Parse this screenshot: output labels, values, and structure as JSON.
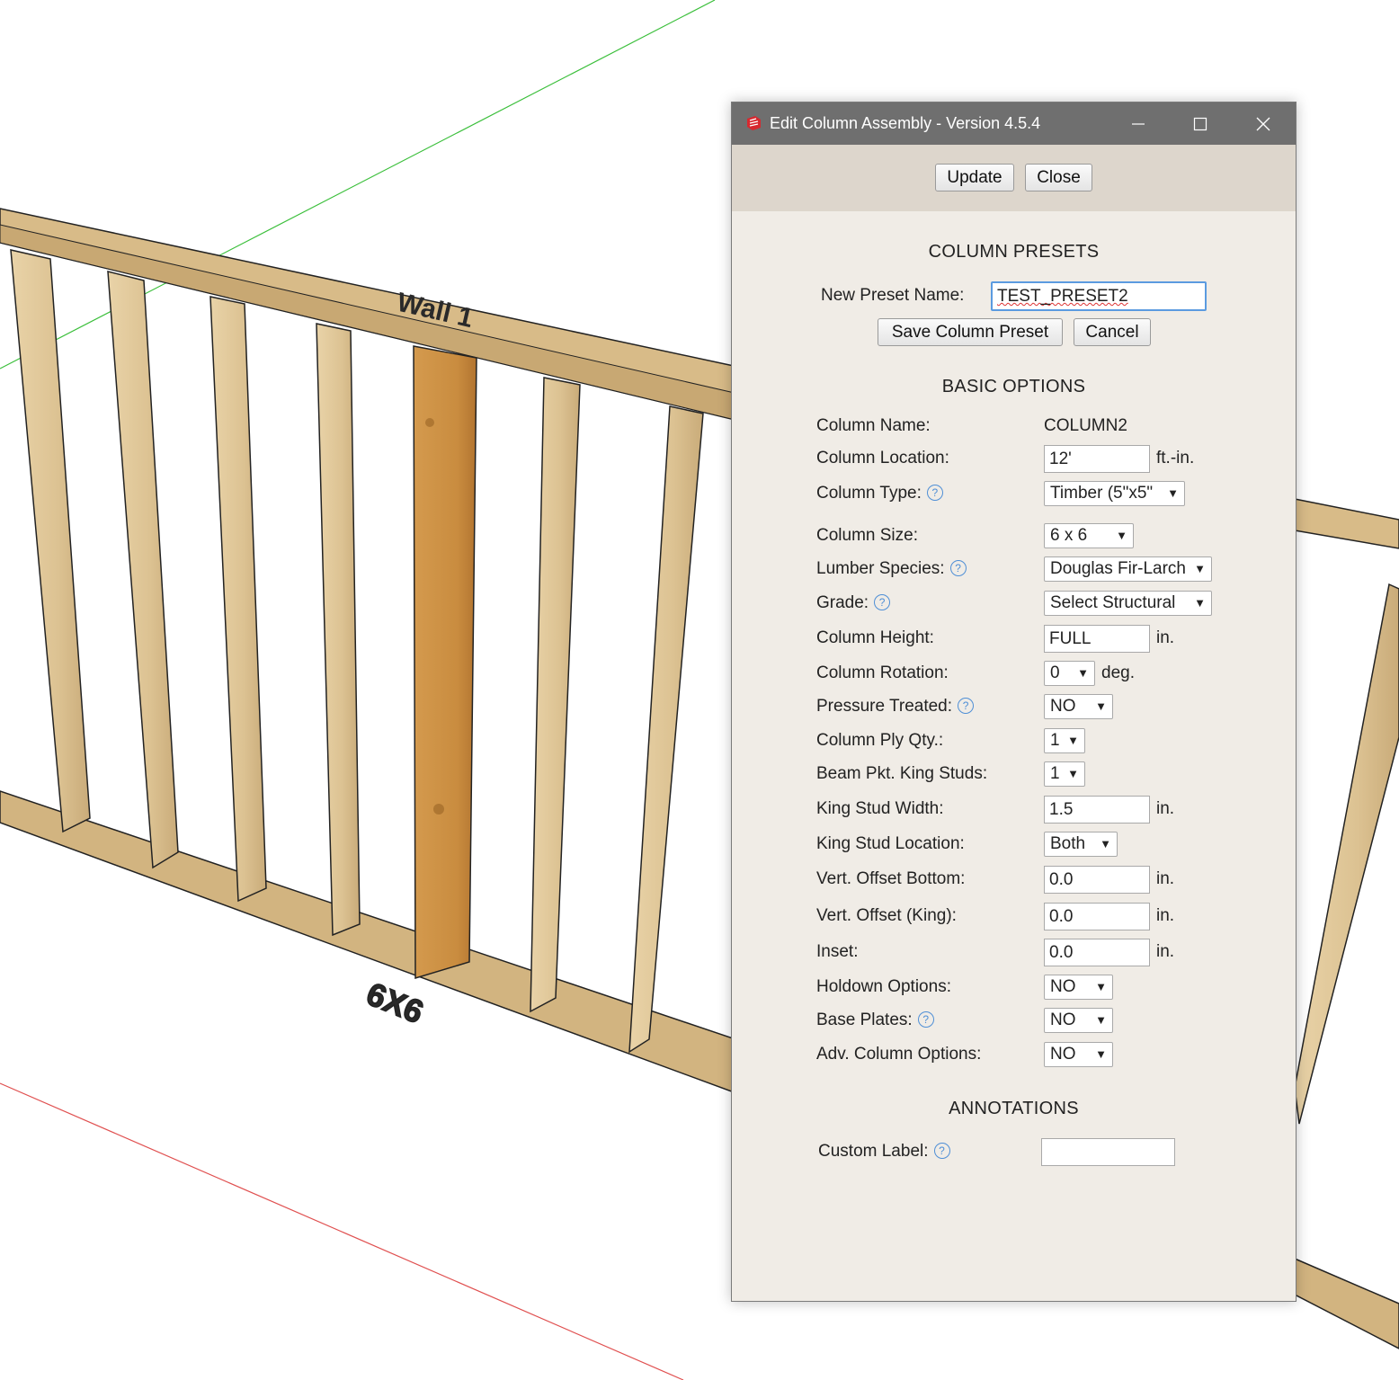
{
  "scene": {
    "wall_label": "Wall 1",
    "column_label": "6X6"
  },
  "dialog": {
    "title": "Edit Column Assembly - Version 4.5.4",
    "window_controls": {
      "minimize_icon": "minimize-icon",
      "maximize_icon": "maximize-icon",
      "close_icon": "close-icon"
    },
    "toolbar": {
      "update_label": "Update",
      "close_label": "Close"
    },
    "presets": {
      "heading": "COLUMN PRESETS",
      "new_name_label": "New Preset Name:",
      "new_name_value": "TEST_PRESET2",
      "save_label": "Save Column Preset",
      "cancel_label": "Cancel"
    },
    "basic": {
      "heading": "BASIC OPTIONS",
      "column_name_label": "Column Name:",
      "column_name_value": "COLUMN2",
      "location_label": "Column Location:",
      "location_value": "12'",
      "location_unit": "ft.-in.",
      "type_label": "Column Type:",
      "type_value": "Timber (5\"x5\"",
      "size_label": "Column Size:",
      "size_value": "6 x 6",
      "species_label": "Lumber Species:",
      "species_value": "Douglas Fir-Larch",
      "grade_label": "Grade:",
      "grade_value": "Select Structural",
      "height_label": "Column Height:",
      "height_value": "FULL",
      "height_unit": "in.",
      "rotation_label": "Column Rotation:",
      "rotation_value": "0",
      "rotation_unit": "deg.",
      "pressure_label": "Pressure Treated:",
      "pressure_value": "NO",
      "ply_label": "Column Ply Qty.:",
      "ply_value": "1",
      "king_studs_label": "Beam Pkt. King Studs:",
      "king_studs_value": "1",
      "king_width_label": "King Stud Width:",
      "king_width_value": "1.5",
      "king_width_unit": "in.",
      "king_location_label": "King Stud Location:",
      "king_location_value": "Both",
      "offset_bottom_label": "Vert. Offset Bottom:",
      "offset_bottom_value": "0.0",
      "offset_bottom_unit": "in.",
      "offset_king_label": "Vert. Offset (King):",
      "offset_king_value": "0.0",
      "offset_king_unit": "in.",
      "inset_label": "Inset:",
      "inset_value": "0.0",
      "inset_unit": "in.",
      "holdown_label": "Holdown Options:",
      "holdown_value": "NO",
      "base_plates_label": "Base Plates:",
      "base_plates_value": "NO",
      "adv_label": "Adv. Column Options:",
      "adv_value": "NO"
    },
    "annotations": {
      "heading": "ANNOTATIONS",
      "custom_label_label": "Custom Label:",
      "custom_label_value": ""
    },
    "help_glyph": "?",
    "dropdown_glyph": "▼"
  }
}
